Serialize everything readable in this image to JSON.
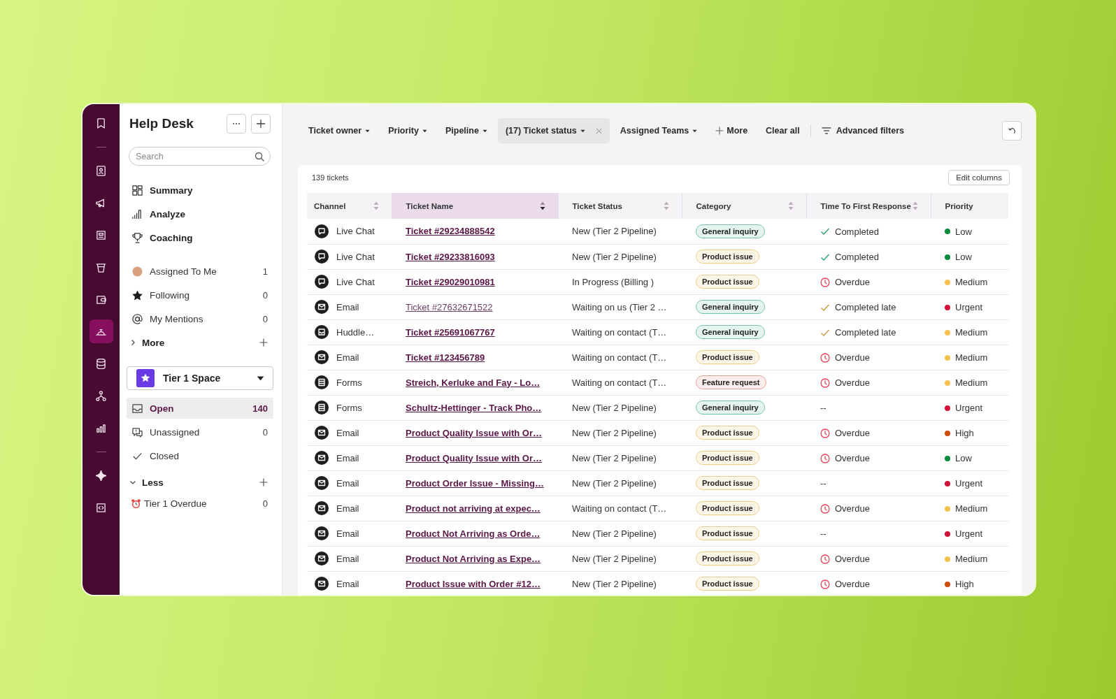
{
  "rail": [
    {
      "selected": false
    },
    {
      "selected": false
    },
    {
      "selected": false
    },
    {
      "selected": false
    },
    {
      "selected": false
    },
    {
      "selected": false
    },
    {
      "selected": true
    },
    {
      "selected": false
    },
    {
      "selected": false
    },
    {
      "selected": false
    },
    {
      "selected": false
    },
    {
      "selected": false
    }
  ],
  "sidebar": {
    "title": "Help Desk",
    "search": {
      "placeholder": "Search"
    },
    "primary_nav": [
      {
        "label": "Summary"
      },
      {
        "label": "Analyze"
      },
      {
        "label": "Coaching"
      }
    ],
    "personal": [
      {
        "label": "Assigned To Me",
        "count": "1"
      },
      {
        "label": "Following",
        "count": "0"
      },
      {
        "label": "My Mentions",
        "count": "0"
      }
    ],
    "more_toggle": {
      "label": "More",
      "expanded": false
    },
    "space": {
      "label": "Tier 1 Space"
    },
    "views": [
      {
        "label": "Open",
        "count": "140",
        "selected": true
      },
      {
        "label": "Unassigned",
        "count": "0",
        "selected": false
      },
      {
        "label": "Closed",
        "selected": false
      }
    ],
    "less_toggle": {
      "label": "Less",
      "expanded": true
    },
    "custom_views": [
      {
        "label": "Tier 1 Overdue",
        "count": "0"
      }
    ]
  },
  "filters": [
    {
      "kind": "dropdown",
      "label": "Ticket owner",
      "applied": false
    },
    {
      "kind": "dropdown",
      "label": "Priority",
      "applied": false
    },
    {
      "kind": "dropdown",
      "label": "Pipeline",
      "applied": false
    },
    {
      "kind": "dropdown",
      "label": "(17) Ticket status",
      "applied": true
    },
    {
      "kind": "dropdown",
      "label": "Assigned Teams",
      "applied": false
    },
    {
      "kind": "add",
      "label": "More"
    },
    {
      "kind": "clear",
      "label": "Clear all"
    },
    {
      "kind": "advanced",
      "label": "Advanced filters"
    }
  ],
  "ticket_count": "139 tickets",
  "edit_columns": "Edit columns",
  "table": {
    "columns": [
      {
        "label": "Channel",
        "sortable": true,
        "selected": false
      },
      {
        "label": "Ticket Name",
        "sortable": true,
        "selected": true
      },
      {
        "label": "Ticket Status",
        "sortable": true,
        "selected": false
      },
      {
        "label": "Category",
        "sortable": true,
        "selected": false
      },
      {
        "label": "Time To First Response",
        "sortable": true,
        "selected": false
      },
      {
        "label": "Priority",
        "sortable": false,
        "selected": false
      }
    ],
    "rows": [
      {
        "channel": {
          "kind": "chat",
          "text": "Live Chat"
        },
        "name": "Ticket #29234888542",
        "unread": true,
        "status": "New (Tier 2 Pipeline)",
        "category": {
          "text": "General inquiry",
          "color": "#74c7a3"
        },
        "response": {
          "kind": "completed",
          "text": "Completed"
        },
        "priority": {
          "text": "Low",
          "color": "#0b8a3e"
        }
      },
      {
        "channel": {
          "kind": "chat",
          "text": "Live Chat"
        },
        "name": "Ticket #29233816093",
        "unread": true,
        "status": "New (Tier 2 Pipeline)",
        "category": {
          "text": "Product issue",
          "color": "#f0cd86"
        },
        "response": {
          "kind": "completed",
          "text": "Completed"
        },
        "priority": {
          "text": "Low",
          "color": "#0b8a3e"
        }
      },
      {
        "channel": {
          "kind": "chat",
          "text": "Live Chat"
        },
        "name": "Ticket #29029010981",
        "unread": true,
        "status": "In Progress (Billing )",
        "category": {
          "text": "Product issue",
          "color": "#f0cd86"
        },
        "response": {
          "kind": "overdue",
          "text": "Overdue"
        },
        "priority": {
          "text": "Medium",
          "color": "#f5c24c"
        }
      },
      {
        "channel": {
          "kind": "email",
          "text": "Email"
        },
        "name": "Ticket #27632671522",
        "unread": false,
        "status": "Waiting on us (Tier 2 …",
        "category": {
          "text": "General inquiry",
          "color": "#74c7a3"
        },
        "response": {
          "kind": "late",
          "text": "Completed late"
        },
        "priority": {
          "text": "Urgent",
          "color": "#d3103a"
        }
      },
      {
        "channel": {
          "kind": "huddle",
          "text": "Huddle…"
        },
        "name": "Ticket #25691067767",
        "unread": true,
        "status": "Waiting on contact (T…",
        "category": {
          "text": "General inquiry",
          "color": "#74c7a3"
        },
        "response": {
          "kind": "late",
          "text": "Completed late"
        },
        "priority": {
          "text": "Medium",
          "color": "#f5c24c"
        }
      },
      {
        "channel": {
          "kind": "email",
          "text": "Email"
        },
        "name": "Ticket #123456789",
        "unread": true,
        "status": "Waiting on contact (T…",
        "category": {
          "text": "Product issue",
          "color": "#f0cd86"
        },
        "response": {
          "kind": "overdue",
          "text": "Overdue"
        },
        "priority": {
          "text": "Medium",
          "color": "#f5c24c"
        }
      },
      {
        "channel": {
          "kind": "forms",
          "text": "Forms"
        },
        "name": "Streich, Kerluke and Fay - Lo…",
        "unread": true,
        "status": "Waiting on contact (T…",
        "category": {
          "text": "Feature request",
          "color": "#ec9f97"
        },
        "response": {
          "kind": "overdue",
          "text": "Overdue"
        },
        "priority": {
          "text": "Medium",
          "color": "#f5c24c"
        }
      },
      {
        "channel": {
          "kind": "forms",
          "text": "Forms"
        },
        "name": "Schultz-Hettinger - Track Pho…",
        "unread": true,
        "status": "New (Tier 2 Pipeline)",
        "category": {
          "text": "General inquiry",
          "color": "#74c7a3"
        },
        "response": {
          "kind": "none",
          "text": "--"
        },
        "priority": {
          "text": "Urgent",
          "color": "#d3103a"
        }
      },
      {
        "channel": {
          "kind": "email",
          "text": "Email"
        },
        "name": "Product Quality Issue with Or…",
        "unread": true,
        "status": "New (Tier 2 Pipeline)",
        "category": {
          "text": "Product issue",
          "color": "#f0cd86"
        },
        "response": {
          "kind": "overdue",
          "text": "Overdue"
        },
        "priority": {
          "text": "High",
          "color": "#d04a0c"
        }
      },
      {
        "channel": {
          "kind": "email",
          "text": "Email"
        },
        "name": "Product Quality Issue with Or…",
        "unread": true,
        "status": "New (Tier 2 Pipeline)",
        "category": {
          "text": "Product issue",
          "color": "#f0cd86"
        },
        "response": {
          "kind": "overdue",
          "text": "Overdue"
        },
        "priority": {
          "text": "Low",
          "color": "#0b8a3e"
        }
      },
      {
        "channel": {
          "kind": "email",
          "text": "Email"
        },
        "name": "Product Order Issue - Missing…",
        "unread": true,
        "status": "New (Tier 2 Pipeline)",
        "category": {
          "text": "Product issue",
          "color": "#f0cd86"
        },
        "response": {
          "kind": "none",
          "text": "--"
        },
        "priority": {
          "text": "Urgent",
          "color": "#d3103a"
        }
      },
      {
        "channel": {
          "kind": "email",
          "text": "Email"
        },
        "name": "Product not arriving at expec…",
        "unread": true,
        "status": "Waiting on contact (T…",
        "category": {
          "text": "Product issue",
          "color": "#f0cd86"
        },
        "response": {
          "kind": "overdue",
          "text": "Overdue"
        },
        "priority": {
          "text": "Medium",
          "color": "#f5c24c"
        }
      },
      {
        "channel": {
          "kind": "email",
          "text": "Email"
        },
        "name": "Product Not Arriving as Orde…",
        "unread": true,
        "status": "New (Tier 2 Pipeline)",
        "category": {
          "text": "Product issue",
          "color": "#f0cd86"
        },
        "response": {
          "kind": "none",
          "text": "--"
        },
        "priority": {
          "text": "Urgent",
          "color": "#d3103a"
        }
      },
      {
        "channel": {
          "kind": "email",
          "text": "Email"
        },
        "name": "Product Not Arriving as Expe…",
        "unread": true,
        "status": "New (Tier 2 Pipeline)",
        "category": {
          "text": "Product issue",
          "color": "#f0cd86"
        },
        "response": {
          "kind": "overdue",
          "text": "Overdue"
        },
        "priority": {
          "text": "Medium",
          "color": "#f5c24c"
        }
      },
      {
        "channel": {
          "kind": "email",
          "text": "Email"
        },
        "name": "Product Issue with Order #12…",
        "unread": true,
        "status": "New (Tier 2 Pipeline)",
        "category": {
          "text": "Product issue",
          "color": "#f0cd86"
        },
        "response": {
          "kind": "overdue",
          "text": "Overdue"
        },
        "priority": {
          "text": "High",
          "color": "#d04a0c"
        }
      }
    ]
  }
}
